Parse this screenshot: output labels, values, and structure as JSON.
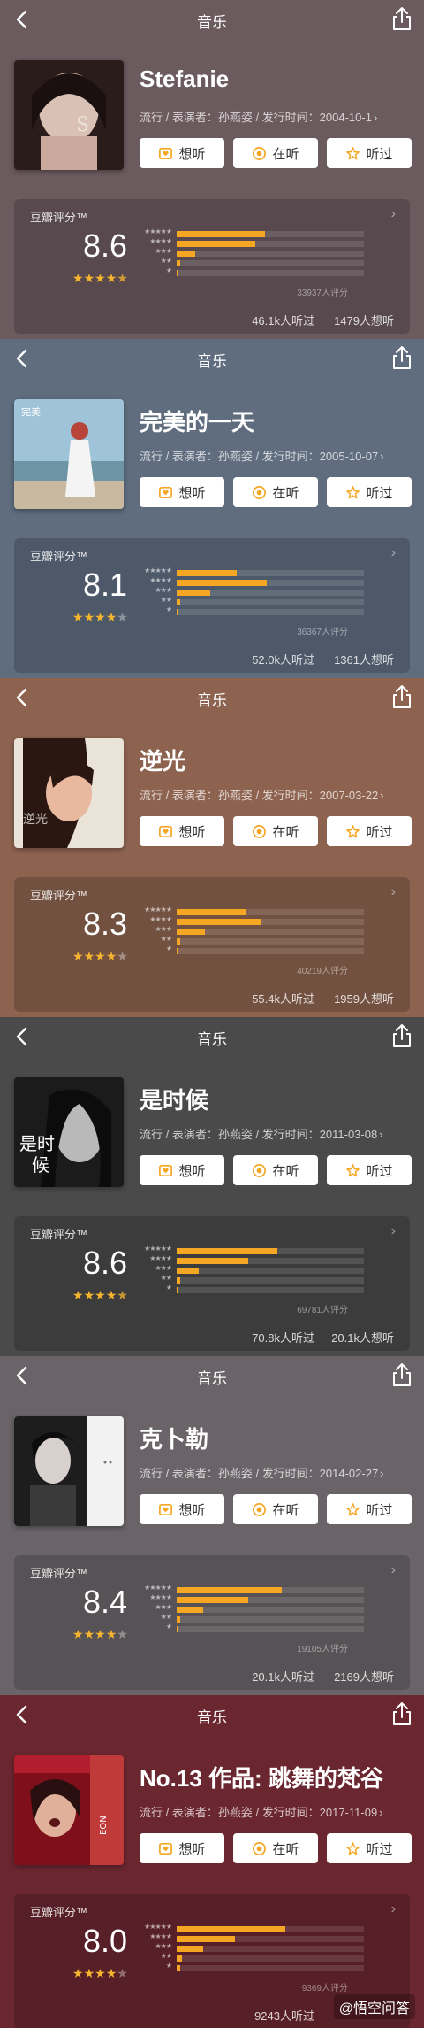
{
  "colors": {
    "star_on": "#f5b52e",
    "bar_fill": "#f5a623"
  },
  "icons": {
    "back": "chevron-left-icon",
    "share": "share-icon",
    "want": "heart-note-icon",
    "listening": "dot-circle-icon",
    "heard": "star-outline-icon"
  },
  "panels": [
    {
      "bg": "#6b5a5e",
      "nav_title": "音乐",
      "album": "Stefanie",
      "meta": "流行 / 表演者：孙燕姿 / 发行时间：2004-10-1",
      "btn_want": "想听",
      "btn_listening": "在听",
      "btn_heard": "听过",
      "rating_label": "豆瓣评分™",
      "score": "8.6",
      "star_levels": [
        "5",
        "4",
        "3",
        "2",
        "1"
      ],
      "dist_ratio": [
        0.47,
        0.42,
        0.1,
        0.02,
        0.01
      ],
      "rating_count": "33937人评分",
      "listened": "46.1k人听过",
      "wanted": "1479人想听",
      "stars": 4.5
    },
    {
      "bg": "#5f6d7f",
      "nav_title": "音乐",
      "album": "完美的一天",
      "meta": "流行 / 表演者：孙燕姿 / 发行时间：2005-10-07",
      "btn_want": "想听",
      "btn_listening": "在听",
      "btn_heard": "听过",
      "rating_label": "豆瓣评分™",
      "score": "8.1",
      "star_levels": [
        "5",
        "4",
        "3",
        "2",
        "1"
      ],
      "dist_ratio": [
        0.32,
        0.48,
        0.18,
        0.02,
        0.01
      ],
      "rating_count": "36367人评分",
      "listened": "52.0k人听过",
      "wanted": "1361人想听",
      "stars": 4
    },
    {
      "bg": "#8d6350",
      "nav_title": "音乐",
      "album": "逆光",
      "meta": "流行 / 表演者：孙燕姿 / 发行时间：2007-03-22",
      "btn_want": "想听",
      "btn_listening": "在听",
      "btn_heard": "听过",
      "rating_label": "豆瓣评分™",
      "score": "8.3",
      "star_levels": [
        "5",
        "4",
        "3",
        "2",
        "1"
      ],
      "dist_ratio": [
        0.37,
        0.45,
        0.15,
        0.02,
        0.01
      ],
      "rating_count": "40219人评分",
      "listened": "55.4k人听过",
      "wanted": "1959人想听",
      "stars": 4
    },
    {
      "bg": "#4a4a4a",
      "nav_title": "音乐",
      "album": "是时候",
      "meta": "流行 / 表演者：孙燕姿 / 发行时间：2011-03-08",
      "btn_want": "想听",
      "btn_listening": "在听",
      "btn_heard": "听过",
      "rating_label": "豆瓣评分™",
      "score": "8.6",
      "star_levels": [
        "5",
        "4",
        "3",
        "2",
        "1"
      ],
      "dist_ratio": [
        0.54,
        0.38,
        0.12,
        0.02,
        0.01
      ],
      "rating_count": "69781人评分",
      "listened": "70.8k人听过",
      "wanted": "20.1k人想听",
      "stars": 4.5
    },
    {
      "bg": "#6a6468",
      "nav_title": "音乐",
      "album": "克卜勒",
      "meta": "流行 / 表演者：孙燕姿 / 发行时间：2014-02-27",
      "btn_want": "想听",
      "btn_listening": "在听",
      "btn_heard": "听过",
      "rating_label": "豆瓣评分™",
      "score": "8.4",
      "star_levels": [
        "5",
        "4",
        "3",
        "2",
        "1"
      ],
      "dist_ratio": [
        0.56,
        0.38,
        0.14,
        0.02,
        0.01
      ],
      "rating_count": "19105人评分",
      "listened": "20.1k人听过",
      "wanted": "2169人想听",
      "stars": 4
    },
    {
      "bg": "#6b2730",
      "nav_title": "音乐",
      "album": "No.13 作品: 跳舞的梵谷",
      "meta": "流行 / 表演者：孙燕姿 / 发行时间：2017-11-09",
      "btn_want": "想听",
      "btn_listening": "在听",
      "btn_heard": "听过",
      "rating_label": "豆瓣评分™",
      "score": "8.0",
      "star_levels": [
        "5",
        "4",
        "3",
        "2",
        "1"
      ],
      "dist_ratio": [
        0.58,
        0.31,
        0.14,
        0.03,
        0.02
      ],
      "rating_count": "9369人评分",
      "listened": "9243人听过",
      "wanted": "",
      "stars": 4
    }
  ],
  "watermark": "@悟空问答"
}
